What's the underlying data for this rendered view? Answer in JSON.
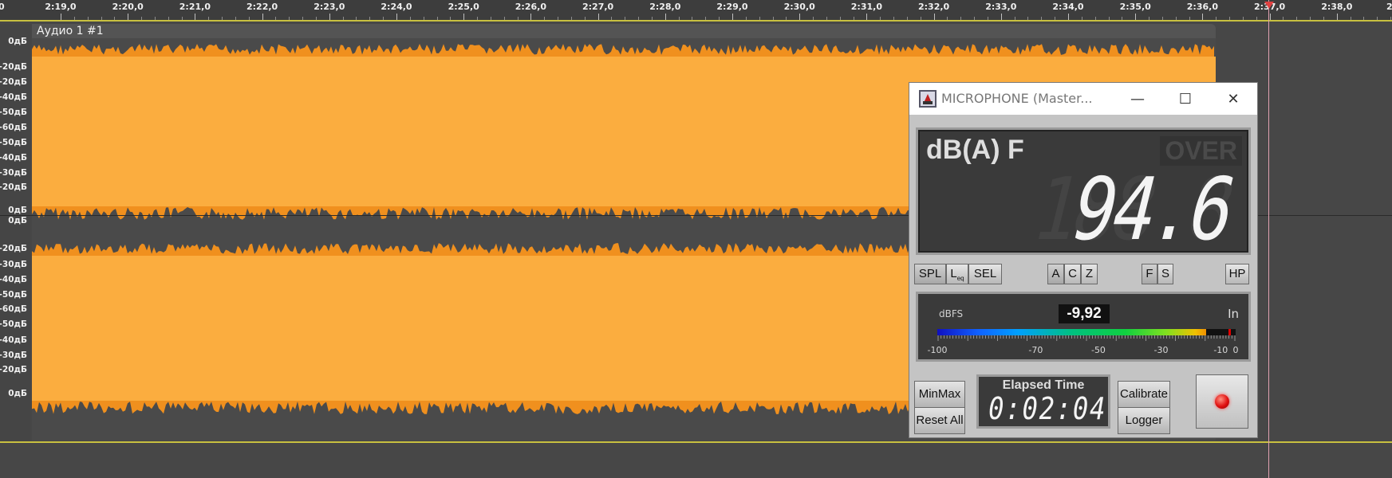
{
  "ruler": {
    "labels": [
      "2:19,0",
      "2:20,0",
      "2:21,0",
      "2:22,0",
      "2:23,0",
      "2:24,0",
      "2:25,0",
      "2:26,0",
      "2:27,0",
      "2:28,0",
      "2:29,0",
      "2:30,0",
      "2:31,0",
      "2:32,0",
      "2:33,0",
      "2:34,0",
      "2:35,0",
      "2:36,0",
      "2:37,0",
      "2:38,0"
    ],
    "edge_left": "0",
    "edge_right": "2"
  },
  "scale": {
    "ch1": [
      "0дБ",
      "-20дБ",
      "-20дБ",
      "-40дБ",
      "-50дБ",
      "-60дБ",
      "-50дБ",
      "-40дБ",
      "-30дБ",
      "-20дБ",
      "0дБ"
    ],
    "ch2": [
      "0дБ",
      "-20дБ",
      "-30дБ",
      "-40дБ",
      "-50дБ",
      "-60дБ",
      "-50дБ",
      "-40дБ",
      "-30дБ",
      "-20дБ",
      "0дБ"
    ]
  },
  "track": {
    "title": "Аудио 1 #1",
    "waveform_color": "#fbad3f",
    "waveform_edge_color": "#f0901e"
  },
  "meter": {
    "window_title": "MICROPHONE (Master...",
    "minimize": "—",
    "maximize": "☐",
    "close": "✕",
    "weighting": "dB(A) F",
    "over": "OVER",
    "value": "94.6",
    "ghost": "188.8",
    "buttons": {
      "spl": "SPL",
      "leq": "L",
      "leq_sub": "eq",
      "sel": "SEL",
      "a": "A",
      "c": "C",
      "z": "Z",
      "f": "F",
      "s": "S",
      "hp": "HP"
    },
    "dbfs_label": "dBFS",
    "dbfs_value": "-9,92",
    "in_label": "In",
    "level_fraction": 0.9,
    "peak_fraction": 0.975,
    "scale_labels": [
      "-100",
      "-70",
      "-50",
      "-30",
      "-10",
      "0"
    ],
    "minmax": "MinMax",
    "reset_all": "Reset All",
    "elapsed_label": "Elapsed Time",
    "elapsed_value": "0:02:04",
    "calibrate": "Calibrate",
    "logger": "Logger"
  }
}
